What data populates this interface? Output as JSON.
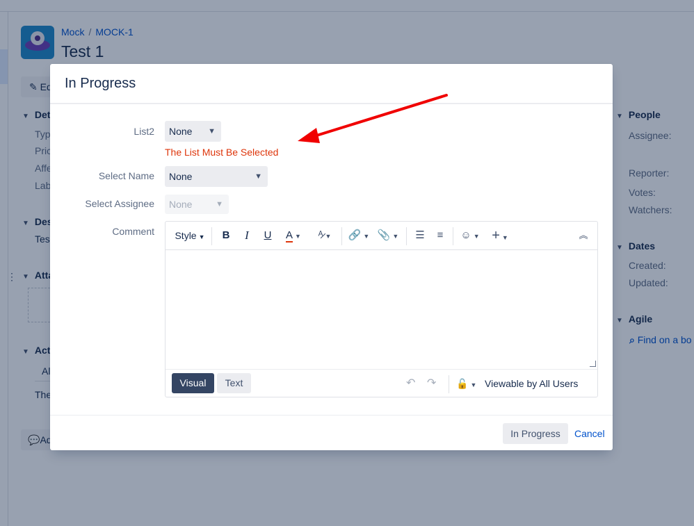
{
  "breadcrumb": {
    "project": "Mock",
    "issue_key": "MOCK-1"
  },
  "issue": {
    "title": "Test 1"
  },
  "background": {
    "edit_partial": "Ed",
    "sections": {
      "details_partial": "Det",
      "description_partial": "Des",
      "attachments_partial": "Atta",
      "activity_partial": "Act",
      "people": "People",
      "dates": "Dates",
      "agile": "Agile"
    },
    "fields_partial": [
      "Typ",
      "Pric",
      "Affe",
      "Lab"
    ],
    "description_text_partial": "Tes",
    "activity_tab_partial": "Al",
    "activity_text_partial": "The",
    "comment_button_partial": "Ad",
    "people_fields": [
      "Assignee:",
      "Reporter:",
      "Votes:",
      "Watchers:"
    ],
    "dates_fields": [
      "Created:",
      "Updated:"
    ],
    "agile_link": "Find on a bo"
  },
  "dialog": {
    "title": "In Progress",
    "fields": {
      "list2": {
        "label": "List2",
        "value": "None"
      },
      "error": "The List Must Be Selected",
      "select_name": {
        "label": "Select Name",
        "value": "None"
      },
      "select_assignee": {
        "label": "Select Assignee",
        "value": "None"
      },
      "comment": {
        "label": "Comment"
      }
    },
    "editor": {
      "style_label": "Style",
      "bold": "B",
      "italic": "I",
      "underline": "U",
      "text_color": "A",
      "mode_visual": "Visual",
      "mode_text": "Text",
      "visibility": "Viewable by All Users"
    },
    "buttons": {
      "submit": "In Progress",
      "cancel": "Cancel"
    }
  },
  "colors": {
    "error": "#de350b",
    "link": "#0052cc",
    "overlay": "rgba(9,30,66,0.42)",
    "arrow": "#f00000"
  }
}
